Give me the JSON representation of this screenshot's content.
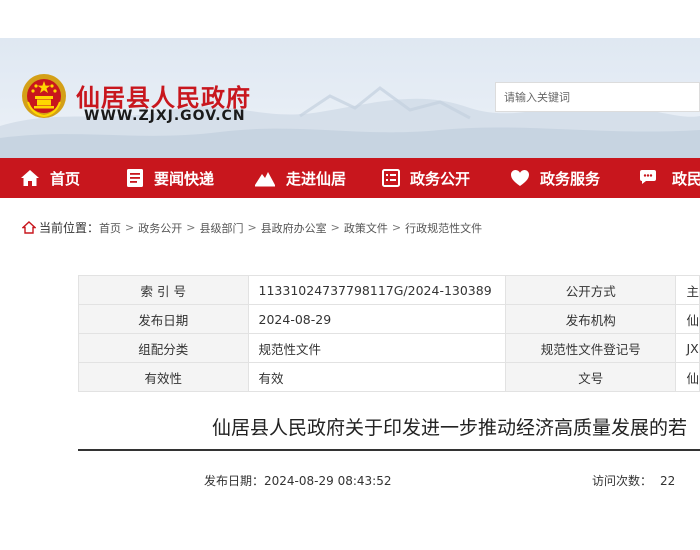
{
  "header": {
    "site_title": "仙居县人民政府",
    "site_url": "WWW.ZJXJ.GOV.CN",
    "search_placeholder": "请输入关键词"
  },
  "nav": {
    "items": [
      {
        "label": "首页",
        "icon": "home-icon"
      },
      {
        "label": "要闻快递",
        "icon": "document-icon"
      },
      {
        "label": "走进仙居",
        "icon": "mountain-icon"
      },
      {
        "label": "政务公开",
        "icon": "list-icon"
      },
      {
        "label": "政务服务",
        "icon": "heart-icon"
      },
      {
        "label": "政民",
        "icon": "chat-icon"
      }
    ]
  },
  "breadcrumb": {
    "label": "当前位置：",
    "items": [
      "首页",
      "政务公开",
      "县级部门",
      "县政府办公室",
      "政策文件",
      "行政规范性文件"
    ]
  },
  "meta_table": {
    "rows": [
      {
        "k1": "索 引 号",
        "v1": "11331024737798117G/2024-130389",
        "k2": "公开方式",
        "v2": "主"
      },
      {
        "k1": "发布日期",
        "v1": "2024-08-29",
        "k2": "发布机构",
        "v2": "仙"
      },
      {
        "k1": "组配分类",
        "v1": "规范性文件",
        "k2": "规范性文件登记号",
        "v2": "JX"
      },
      {
        "k1": "有效性",
        "v1": "有效",
        "k2": "文号",
        "v2": "仙"
      }
    ]
  },
  "document": {
    "title": "仙居县人民政府关于印发进一步推动经济高质量发展的若",
    "publish_label": "发布日期：",
    "publish_value": "2024-08-29 08:43:52",
    "visits_label": "访问次数：",
    "visits_value": "22"
  },
  "colors": {
    "brand_red": "#c8161d",
    "header_bg": "#e4ecf4"
  }
}
